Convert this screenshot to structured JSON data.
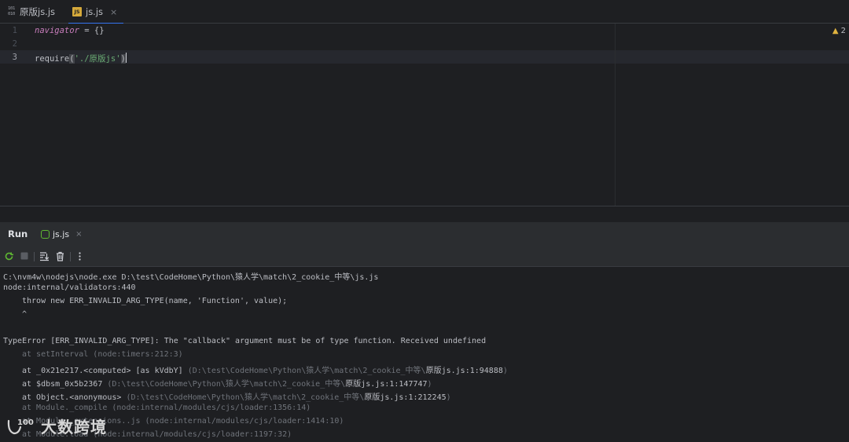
{
  "tabs": [
    {
      "label": "原版js.js",
      "icon": "binary-file-icon"
    },
    {
      "label": "js.js",
      "icon": "js-file-icon",
      "active": true
    }
  ],
  "tab_icon_text": {
    "top": "101",
    "bottom": "010",
    "js": "JS"
  },
  "tab_close_glyph": "×",
  "editor": {
    "line_numbers": [
      "1",
      "2",
      "3"
    ],
    "line1": {
      "ident": "navigator",
      "rest": " = {}"
    },
    "line3": {
      "fn": "require",
      "open": "(",
      "str": "'./原版js'",
      "close": ")"
    },
    "warnings": "2",
    "warning_icon": "warning-icon"
  },
  "run_panel": {
    "title": "Run",
    "tab_label": "js.js",
    "toolbar": [
      "rerun-icon",
      "stop-icon",
      "scroll-to-end-icon",
      "clear-icon",
      "more-icon"
    ]
  },
  "console": [
    {
      "text": "C:\\nvm4w\\nodejs\\node.exe D:\\test\\CodeHome\\Python\\猿人学\\match\\2_cookie_中等\\js.js"
    },
    {
      "text": "node:internal/validators:440"
    },
    {
      "text": "throw new ERR_INVALID_ARG_TYPE(name, 'Function', value);"
    },
    {
      "text": "^"
    },
    {
      "text": ""
    },
    {
      "text": "TypeError [ERR_INVALID_ARG_TYPE]: The \"callback\" argument must be of type function. Received undefined"
    },
    {
      "text": "at setInterval (node:timers:212:3)"
    },
    {
      "main": "at _0x21e217.<computed> [as kVdbY] ",
      "loc": "(D:\\test\\CodeHome\\Python\\猿人学\\match\\2_cookie_中等\\",
      "file": "原版js.js:1:94888",
      "tail": ")"
    },
    {
      "main": "at $dbsm_0x5b2367 ",
      "loc": "(D:\\test\\CodeHome\\Python\\猿人学\\match\\2_cookie_中等\\",
      "file": "原版js.js:1:147747",
      "tail": ")"
    },
    {
      "main": "at Object.<anonymous> ",
      "loc": "(D:\\test\\CodeHome\\Python\\猿人学\\match\\2_cookie_中等\\",
      "file": "原版js.js:1:212245",
      "tail": ")"
    },
    {
      "text": "at Module._compile (node:internal/modules/cjs/loader:1356:14)"
    },
    {
      "text": "at Module._extensions..js (node:internal/modules/cjs/loader:1414:10)"
    },
    {
      "text": "at Module.load (node:internal/modules/cjs/loader:1197:32)"
    }
  ],
  "watermark": {
    "text": "大数跨境",
    "logo": "100"
  }
}
